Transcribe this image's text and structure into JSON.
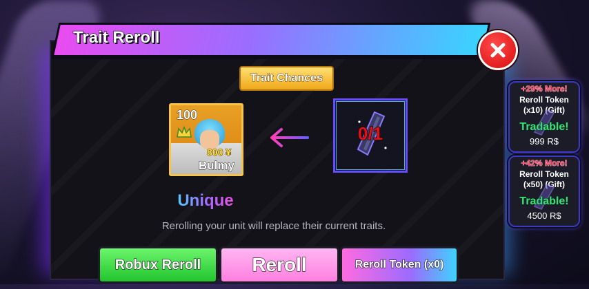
{
  "window": {
    "title": "Trait Reroll"
  },
  "trait_chances_label": "Trait Chances",
  "unit": {
    "level": "100",
    "cost": "800 ¥",
    "name": "Bulmy",
    "rarity": "Unique"
  },
  "token": {
    "count": "0/1"
  },
  "info_text": "Rerolling your unit will replace their current traits.",
  "buttons": {
    "robux_reroll": "Robux Reroll",
    "reroll": "Reroll",
    "reroll_token": "Reroll Token (x0)"
  },
  "shop": [
    {
      "promo": "+29% More!",
      "name": "Reroll Token (x10) (Gift)",
      "tradable": "Tradable!",
      "price": "999 R$"
    },
    {
      "promo": "+42% More!",
      "name": "Reroll Token (x50) (Gift)",
      "tradable": "Tradable!",
      "price": "4500 R$"
    }
  ],
  "colors": {
    "close": "#d80c0c",
    "robux": "#22c52e",
    "reroll": "#ff7fe0",
    "token_count": "#e3101a"
  },
  "icons": {
    "close": "close-icon",
    "arrow": "arrow-left-icon",
    "token": "token-crystal-icon",
    "crown": "crown-icon"
  }
}
